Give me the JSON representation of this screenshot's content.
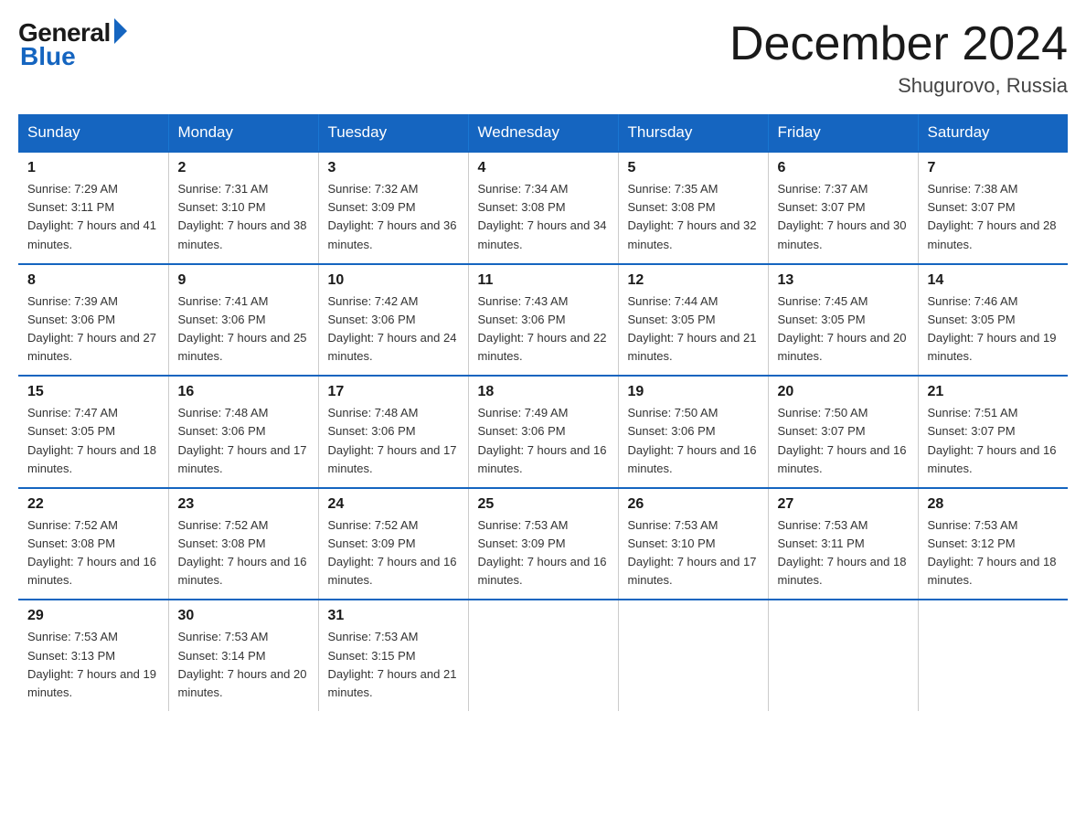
{
  "logo": {
    "general": "General",
    "blue": "Blue"
  },
  "title": "December 2024",
  "location": "Shugurovo, Russia",
  "days_of_week": [
    "Sunday",
    "Monday",
    "Tuesday",
    "Wednesday",
    "Thursday",
    "Friday",
    "Saturday"
  ],
  "weeks": [
    [
      {
        "num": "1",
        "sunrise": "7:29 AM",
        "sunset": "3:11 PM",
        "daylight": "7 hours and 41 minutes."
      },
      {
        "num": "2",
        "sunrise": "7:31 AM",
        "sunset": "3:10 PM",
        "daylight": "7 hours and 38 minutes."
      },
      {
        "num": "3",
        "sunrise": "7:32 AM",
        "sunset": "3:09 PM",
        "daylight": "7 hours and 36 minutes."
      },
      {
        "num": "4",
        "sunrise": "7:34 AM",
        "sunset": "3:08 PM",
        "daylight": "7 hours and 34 minutes."
      },
      {
        "num": "5",
        "sunrise": "7:35 AM",
        "sunset": "3:08 PM",
        "daylight": "7 hours and 32 minutes."
      },
      {
        "num": "6",
        "sunrise": "7:37 AM",
        "sunset": "3:07 PM",
        "daylight": "7 hours and 30 minutes."
      },
      {
        "num": "7",
        "sunrise": "7:38 AM",
        "sunset": "3:07 PM",
        "daylight": "7 hours and 28 minutes."
      }
    ],
    [
      {
        "num": "8",
        "sunrise": "7:39 AM",
        "sunset": "3:06 PM",
        "daylight": "7 hours and 27 minutes."
      },
      {
        "num": "9",
        "sunrise": "7:41 AM",
        "sunset": "3:06 PM",
        "daylight": "7 hours and 25 minutes."
      },
      {
        "num": "10",
        "sunrise": "7:42 AM",
        "sunset": "3:06 PM",
        "daylight": "7 hours and 24 minutes."
      },
      {
        "num": "11",
        "sunrise": "7:43 AM",
        "sunset": "3:06 PM",
        "daylight": "7 hours and 22 minutes."
      },
      {
        "num": "12",
        "sunrise": "7:44 AM",
        "sunset": "3:05 PM",
        "daylight": "7 hours and 21 minutes."
      },
      {
        "num": "13",
        "sunrise": "7:45 AM",
        "sunset": "3:05 PM",
        "daylight": "7 hours and 20 minutes."
      },
      {
        "num": "14",
        "sunrise": "7:46 AM",
        "sunset": "3:05 PM",
        "daylight": "7 hours and 19 minutes."
      }
    ],
    [
      {
        "num": "15",
        "sunrise": "7:47 AM",
        "sunset": "3:05 PM",
        "daylight": "7 hours and 18 minutes."
      },
      {
        "num": "16",
        "sunrise": "7:48 AM",
        "sunset": "3:06 PM",
        "daylight": "7 hours and 17 minutes."
      },
      {
        "num": "17",
        "sunrise": "7:48 AM",
        "sunset": "3:06 PM",
        "daylight": "7 hours and 17 minutes."
      },
      {
        "num": "18",
        "sunrise": "7:49 AM",
        "sunset": "3:06 PM",
        "daylight": "7 hours and 16 minutes."
      },
      {
        "num": "19",
        "sunrise": "7:50 AM",
        "sunset": "3:06 PM",
        "daylight": "7 hours and 16 minutes."
      },
      {
        "num": "20",
        "sunrise": "7:50 AM",
        "sunset": "3:07 PM",
        "daylight": "7 hours and 16 minutes."
      },
      {
        "num": "21",
        "sunrise": "7:51 AM",
        "sunset": "3:07 PM",
        "daylight": "7 hours and 16 minutes."
      }
    ],
    [
      {
        "num": "22",
        "sunrise": "7:52 AM",
        "sunset": "3:08 PM",
        "daylight": "7 hours and 16 minutes."
      },
      {
        "num": "23",
        "sunrise": "7:52 AM",
        "sunset": "3:08 PM",
        "daylight": "7 hours and 16 minutes."
      },
      {
        "num": "24",
        "sunrise": "7:52 AM",
        "sunset": "3:09 PM",
        "daylight": "7 hours and 16 minutes."
      },
      {
        "num": "25",
        "sunrise": "7:53 AM",
        "sunset": "3:09 PM",
        "daylight": "7 hours and 16 minutes."
      },
      {
        "num": "26",
        "sunrise": "7:53 AM",
        "sunset": "3:10 PM",
        "daylight": "7 hours and 17 minutes."
      },
      {
        "num": "27",
        "sunrise": "7:53 AM",
        "sunset": "3:11 PM",
        "daylight": "7 hours and 18 minutes."
      },
      {
        "num": "28",
        "sunrise": "7:53 AM",
        "sunset": "3:12 PM",
        "daylight": "7 hours and 18 minutes."
      }
    ],
    [
      {
        "num": "29",
        "sunrise": "7:53 AM",
        "sunset": "3:13 PM",
        "daylight": "7 hours and 19 minutes."
      },
      {
        "num": "30",
        "sunrise": "7:53 AM",
        "sunset": "3:14 PM",
        "daylight": "7 hours and 20 minutes."
      },
      {
        "num": "31",
        "sunrise": "7:53 AM",
        "sunset": "3:15 PM",
        "daylight": "7 hours and 21 minutes."
      },
      null,
      null,
      null,
      null
    ]
  ]
}
